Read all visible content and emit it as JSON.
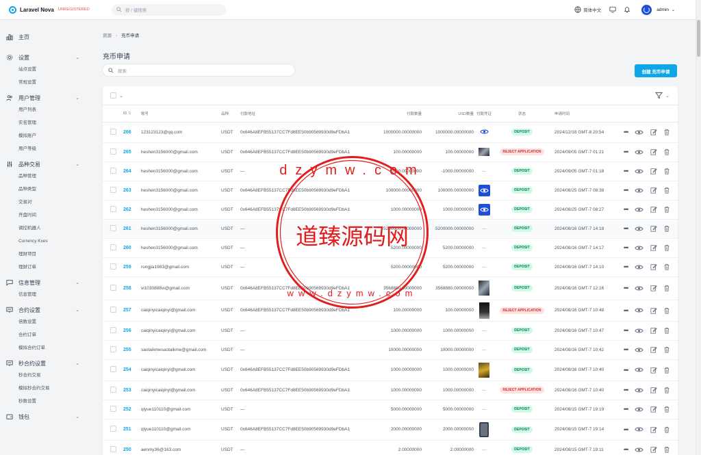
{
  "app": {
    "title": "Laravel Nova",
    "badge": "UNREGISTERED",
    "search_placeholder": "按 / 键搜索"
  },
  "topbar": {
    "language": "简体中文",
    "user": "admin"
  },
  "sidebar": [
    {
      "label": "主页",
      "icon": "chart-bar-icon",
      "items": []
    },
    {
      "label": "设置",
      "icon": "gear-icon",
      "items": [
        "站点设置",
        "常规设置"
      ]
    },
    {
      "label": "用户管理",
      "icon": "users-icon",
      "items": [
        "用户列表",
        "实名管理",
        "模拟账户",
        "用户等级"
      ]
    },
    {
      "label": "品种交易",
      "icon": "adjustments-icon",
      "items": [
        "品种管理",
        "品种类型",
        "交易对",
        "开盘时间",
        "调控机器人",
        "Currency Kxes",
        "理财项目",
        "理财订单"
      ]
    },
    {
      "label": "信息管理",
      "icon": "chat-icon",
      "items": [
        "信息管理"
      ]
    },
    {
      "label": "合约设置",
      "icon": "presentation-icon",
      "items": [
        "倍数设置",
        "合约订单",
        "模拟合约订单"
      ]
    },
    {
      "label": "秒合约设置",
      "icon": "presentation-chart-icon",
      "items": [
        "秒合约交易",
        "模拟秒合约交易",
        "秒数设置"
      ]
    },
    {
      "label": "钱包",
      "icon": "wallet-icon",
      "items": []
    }
  ],
  "breadcrumb": {
    "root": "资源",
    "current": "充币申请"
  },
  "page": {
    "title": "充币申请",
    "search_placeholder": "搜索",
    "create_label": "创建 充币申请"
  },
  "table": {
    "columns": [
      "ID",
      "账号",
      "品种",
      "付款地址",
      "付款数量",
      "USD数量",
      "付款凭证",
      "状态",
      "申请时间"
    ],
    "rows": [
      {
        "id": "266",
        "account": "123123123@qq.com",
        "coin": "USDT",
        "address": "0x646A8EFB55137CC7Fd8EE50b90569930d9eFDbA1",
        "amount": "1000000.00000000",
        "usd": "1000000.00000000",
        "proof": "eye",
        "status": "DEPOSIT",
        "time": "2024/12/18 GMT-8 20:54"
      },
      {
        "id": "265",
        "account": "heshen3156000@gmail.com",
        "coin": "USDT",
        "address": "0x646A8EFB55137CC7Fd8EE50b90569930d9eFDbA1",
        "amount": "100.00000000",
        "usd": "100.00000000",
        "proof": "img",
        "status": "REJECT APPLICATION",
        "time": "2024/09/05 GMT-7 01:21"
      },
      {
        "id": "264",
        "account": "heshen3156000@gmail.com",
        "coin": "USDT",
        "address": "—",
        "amount": "-1000.00000000",
        "usd": "-1000.00000000",
        "proof": "—",
        "status": "DEPOSIT",
        "time": "2024/09/05 GMT-7 01:18"
      },
      {
        "id": "263",
        "account": "heshen3156000@gmail.com",
        "coin": "USDT",
        "address": "0x646A8EFB55137CC7Fd8EE50b90569930d9eFDbA1",
        "amount": "100000.00000000",
        "usd": "100000.00000000",
        "proof": "eye-blue",
        "status": "DEPOSIT",
        "time": "2024/08/25 GMT-7 08:38"
      },
      {
        "id": "262",
        "account": "heshen3156000@gmail.com",
        "coin": "USDT",
        "address": "0x646A8EFB55137CC7Fd8EE50b90569930d9eFDbA1",
        "amount": "1000.00000000",
        "usd": "1000.00000000",
        "proof": "eye-blue",
        "status": "DEPOSIT",
        "time": "2024/08/25 GMT-7 08:27"
      },
      {
        "id": "261",
        "account": "heshen3156000@gmail.com",
        "coin": "USDT",
        "address": "—",
        "amount": "5200000.00000000",
        "usd": "5200000.00000000",
        "proof": "—",
        "status": "DEPOSIT",
        "time": "2024/08/16 GMT-7 14:18"
      },
      {
        "id": "260",
        "account": "heshen3156000@gmail.com",
        "coin": "USDT",
        "address": "—",
        "amount": "5200.00000000",
        "usd": "5200.00000000",
        "proof": "—",
        "status": "DEPOSIT",
        "time": "2024/08/16 GMT-7 14:17"
      },
      {
        "id": "259",
        "account": "rongjia1983@gmail.com",
        "coin": "USDT",
        "address": "—",
        "amount": "5200.00000000",
        "usd": "5200.00000000",
        "proof": "—",
        "status": "DEPOSIT",
        "time": "2024/08/16 GMT-7 14:10"
      },
      {
        "id": "258",
        "account": "vi1030888vi@gmail.com",
        "coin": "USDT",
        "address": "0x646A8EFB55137CC7Fd8EE50b90569930d9eFDbA1",
        "amount": "3568880.00000000",
        "usd": "3568880.00000000",
        "proof": "img",
        "status": "DEPOSIT",
        "time": "2024/08/16 GMT-7 12:16"
      },
      {
        "id": "257",
        "account": "caiqinyicaiqinyi@gmail.com",
        "coin": "USDT",
        "address": "0x646A8EFB55137CC7Fd8EE50b90569930d9eFDbA1",
        "amount": "100.00000000",
        "usd": "100.00000000",
        "proof": "img-dark",
        "status": "REJECT APPLICATION",
        "time": "2024/08/16 GMT-7 10:48"
      },
      {
        "id": "256",
        "account": "caiqinyicaiqinyi@gmail.com",
        "coin": "USDT",
        "address": "—",
        "amount": "1000.00000000",
        "usd": "1000.00000000",
        "proof": "—",
        "status": "DEPOSIT",
        "time": "2024/08/16 GMT-7 10:47"
      },
      {
        "id": "255",
        "account": "saotaikmesaotaikme@gmail.com",
        "coin": "USDT",
        "address": "—",
        "amount": "10000.00000000",
        "usd": "10000.00000000",
        "proof": "—",
        "status": "DEPOSIT",
        "time": "2024/08/16 GMT-7 10:42"
      },
      {
        "id": "254",
        "account": "caiqinyicaiqinyi@gmail.com",
        "coin": "USDT",
        "address": "0x646A8EFB55137CC7Fd8EE50b90569930d9eFDbA1",
        "amount": "1000.00000000",
        "usd": "1000.00000000",
        "proof": "img-gold",
        "status": "DEPOSIT",
        "time": "2024/08/16 GMT-7 10:40"
      },
      {
        "id": "253",
        "account": "caiqinyicaiqinyi@gmail.com",
        "coin": "USDT",
        "address": "0x646A8EFB55137CC7Fd8EE50b90569930d9eFDbA1",
        "amount": "1000.00000000",
        "usd": "1000.00000000",
        "proof": "—",
        "status": "REJECT APPLICATION",
        "time": "2024/08/16 GMT-7 10:40"
      },
      {
        "id": "252",
        "account": "qiyue110110@gmail.com",
        "coin": "USDT",
        "address": "—",
        "amount": "5000.00000000",
        "usd": "5000.00000000",
        "proof": "—",
        "status": "DEPOSIT",
        "time": "2024/08/15 GMT-7 19:19"
      },
      {
        "id": "251",
        "account": "qiyue110110@gmail.com",
        "coin": "USDT",
        "address": "0x646A8EFB55137CC7Fd8EE50b90569930d9eFDbA1",
        "amount": "2000.00000000",
        "usd": "2000.00000000",
        "proof": "img-phone",
        "status": "DEPOSIT",
        "time": "2024/08/15 GMT-7 19:14"
      },
      {
        "id": "250",
        "account": "aenmy36@163.com",
        "coin": "USDT",
        "address": "—",
        "amount": "2.00000000",
        "usd": "2.00000000",
        "proof": "—",
        "status": "DEPOSIT",
        "time": "2024/08/15 GMT-7 19:11"
      }
    ]
  },
  "watermark": {
    "text": "道臻源码网",
    "url_top": "dzymw.com",
    "url_bottom": "www.dzymw.com",
    "color": "#e11d1d"
  }
}
